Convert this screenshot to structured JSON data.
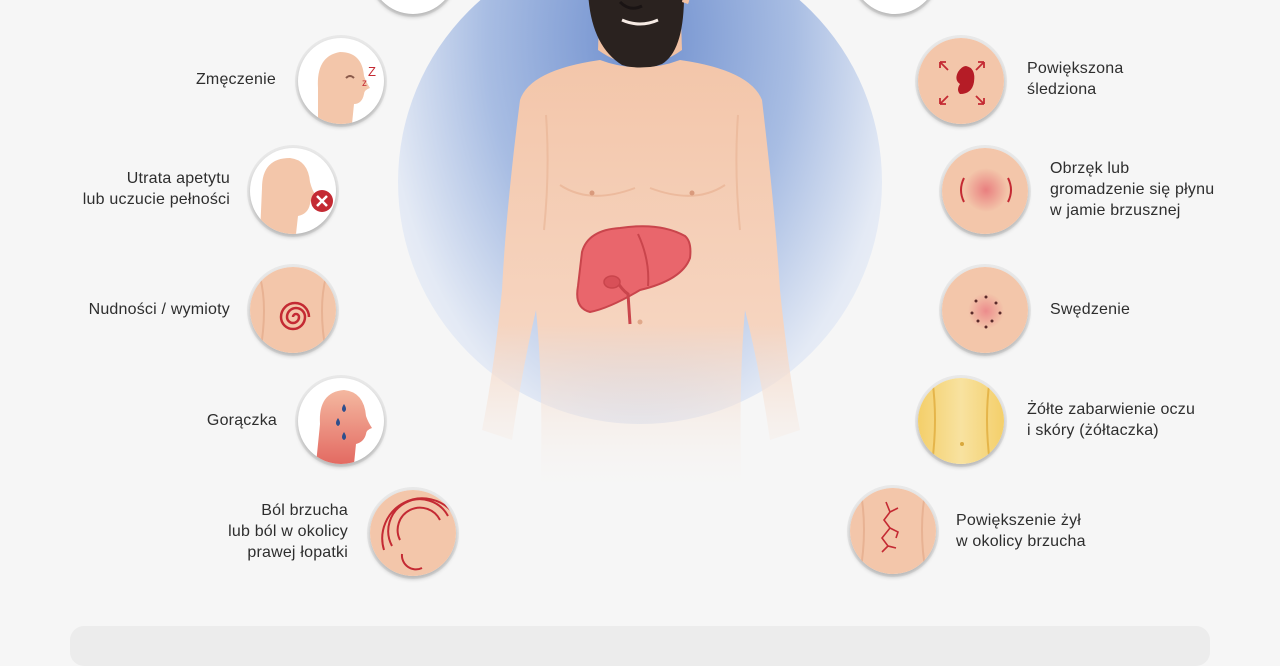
{
  "symptoms_left": [
    {
      "id": "fatigue",
      "lines": [
        "Zmęczenie"
      ],
      "icon": "sleeping-face-icon"
    },
    {
      "id": "appetite",
      "lines": [
        "Utrata apetytu",
        "lub uczucie pełności"
      ],
      "icon": "no-eating-icon"
    },
    {
      "id": "nausea",
      "lines": [
        "Nudności / wymioty"
      ],
      "icon": "spiral-stomach-icon"
    },
    {
      "id": "fever",
      "lines": [
        "Gorączka"
      ],
      "icon": "sweating-head-icon"
    },
    {
      "id": "abdominal-pain",
      "lines": [
        "Ból brzucha",
        "lub ból w okolicy",
        "prawej łopatki"
      ],
      "icon": "pain-waves-icon"
    }
  ],
  "symptoms_right": [
    {
      "id": "enlarged-spleen",
      "lines": [
        "Powiększona",
        "śledziona"
      ],
      "icon": "spleen-icon"
    },
    {
      "id": "ascites",
      "lines": [
        "Obrzęk lub",
        "gromadzenie się płynu",
        "w jamie brzusznej"
      ],
      "icon": "swollen-belly-icon"
    },
    {
      "id": "itching",
      "lines": [
        "Swędzenie"
      ],
      "icon": "itch-dots-icon"
    },
    {
      "id": "jaundice",
      "lines": [
        "Żółte zabarwienie oczu",
        "i skóry (żółtaczka)"
      ],
      "icon": "yellow-skin-icon"
    },
    {
      "id": "veins",
      "lines": [
        "Powiększenie żył",
        "w okolicy brzucha"
      ],
      "icon": "veins-icon"
    }
  ],
  "figure": {
    "organ": "liver-icon",
    "subject": "man-torso-illustration"
  },
  "colors": {
    "skin": "#f6cdb4",
    "liver": "#e9666c",
    "accent_red": "#c42a33",
    "halo": "#8aa3d6",
    "jaundice": "#f6d57a"
  }
}
